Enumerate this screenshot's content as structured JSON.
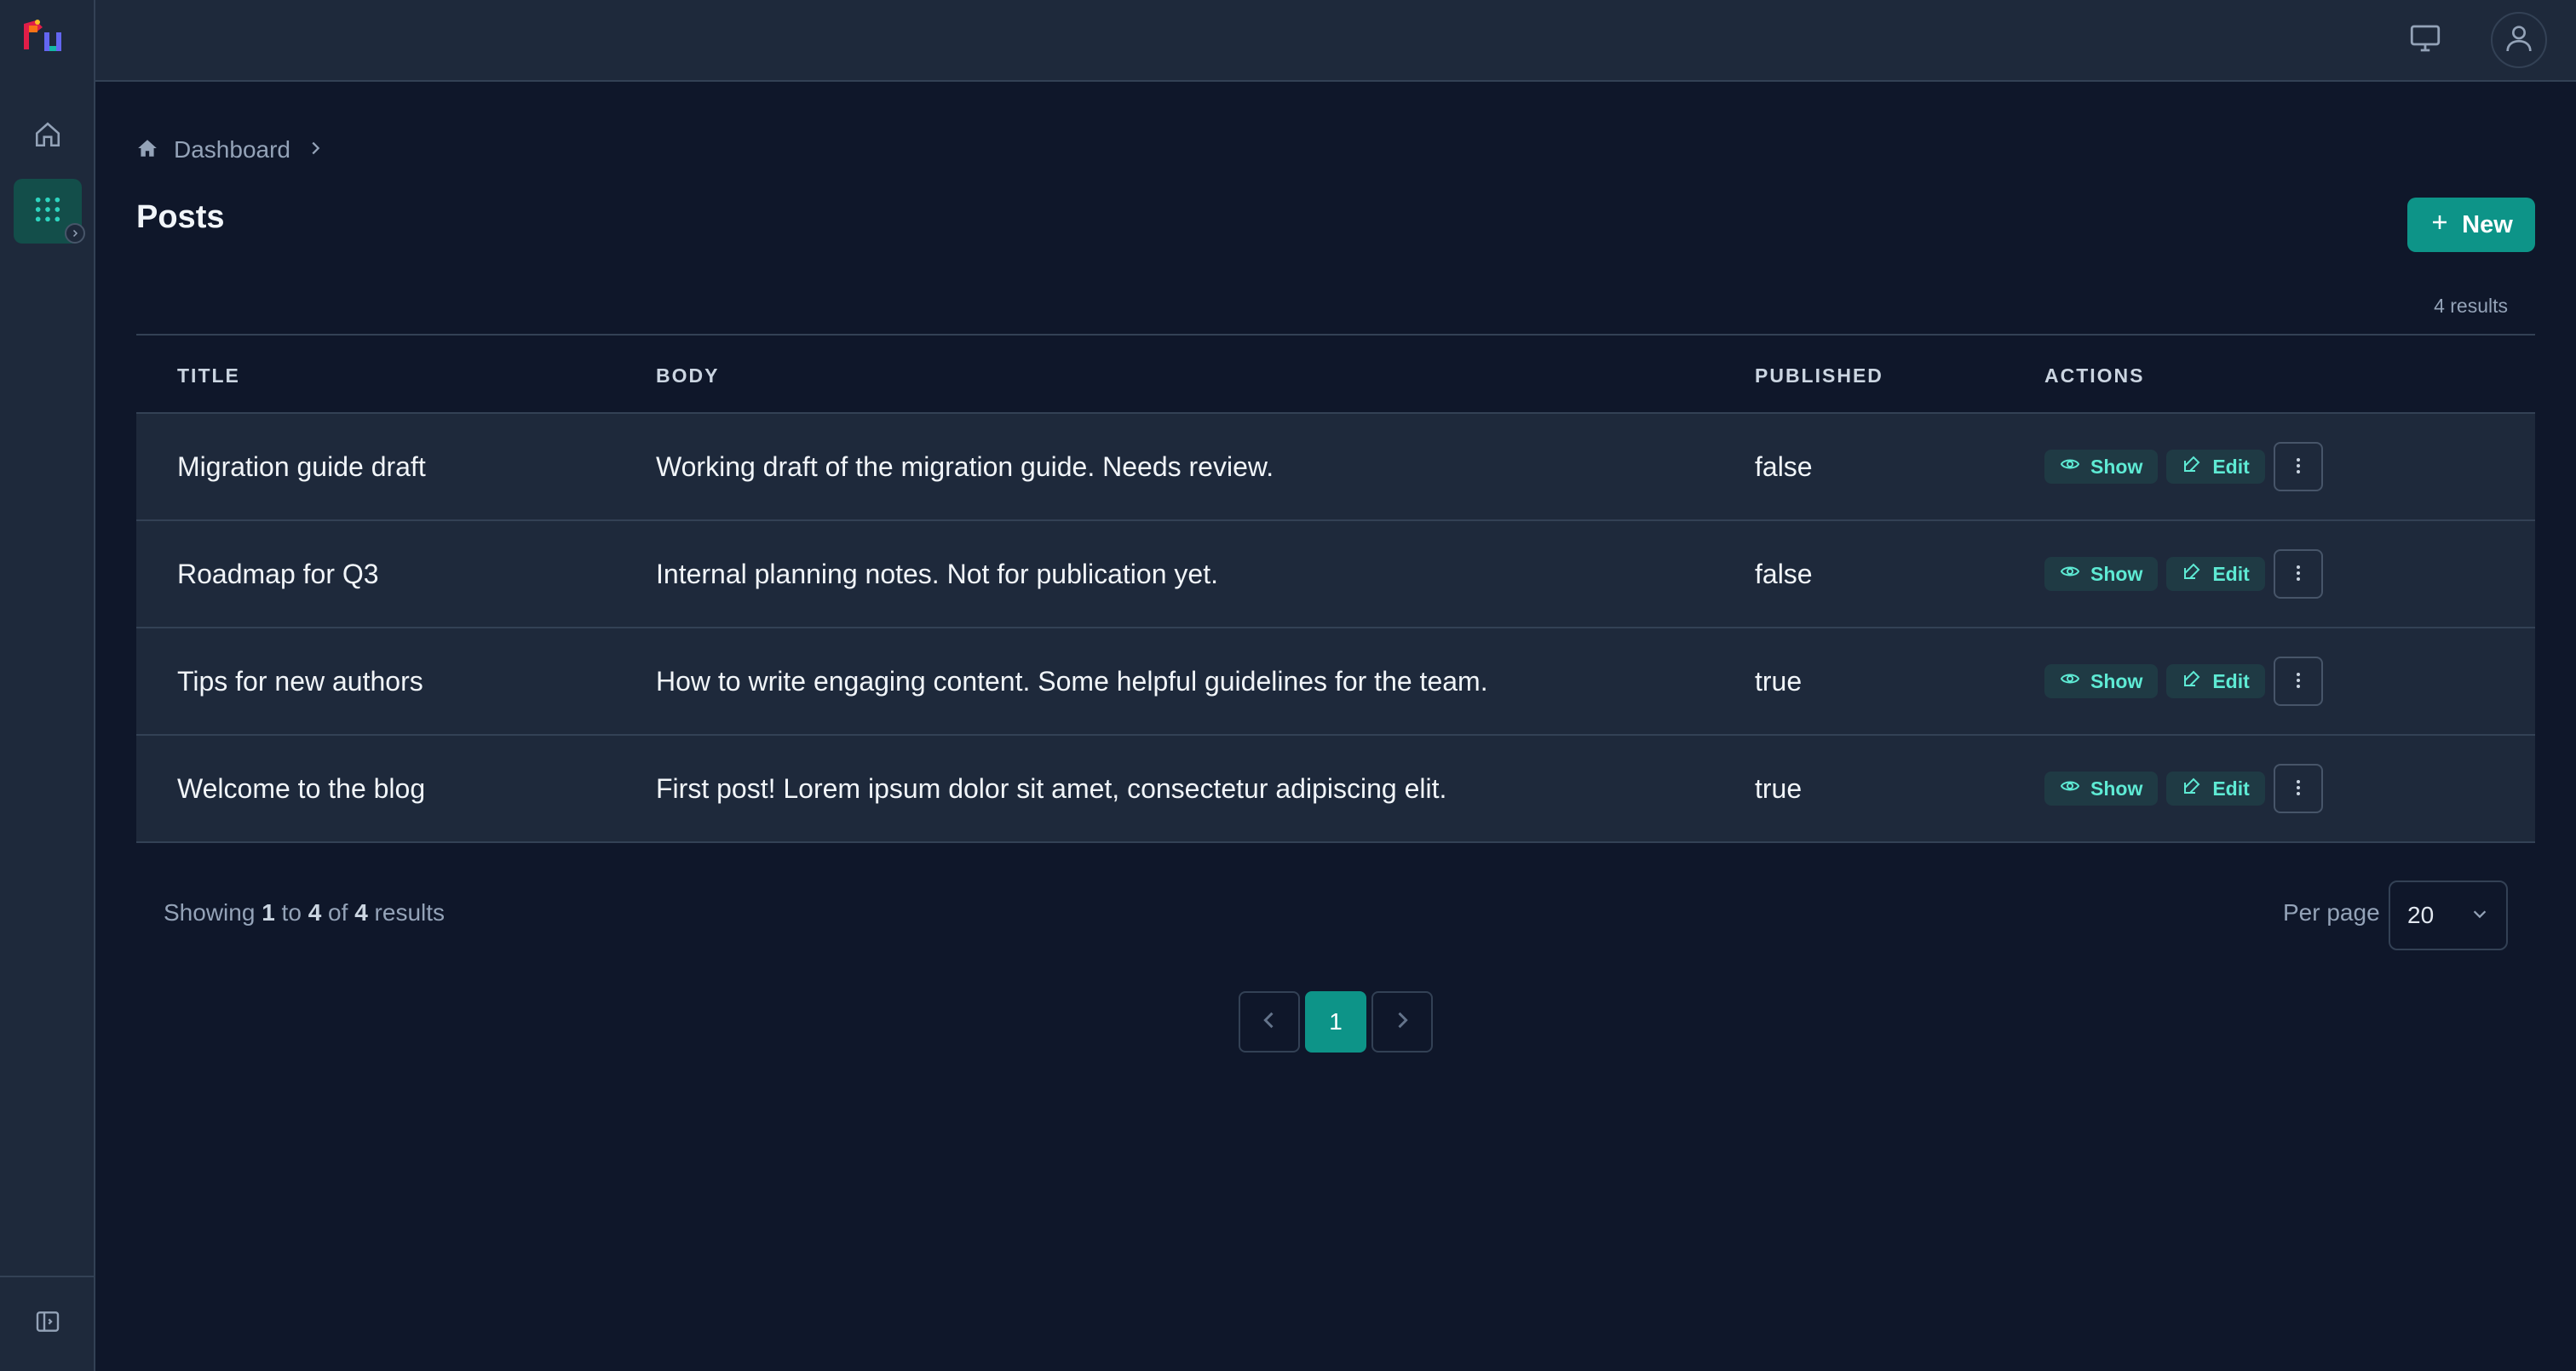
{
  "breadcrumb": {
    "home_icon": "home-icon",
    "current": "Dashboard"
  },
  "page": {
    "title": "Posts",
    "new_button": "New",
    "result_count": "4 results"
  },
  "table": {
    "headers": [
      "TITLE",
      "BODY",
      "PUBLISHED",
      "ACTIONS"
    ],
    "rows": [
      {
        "title": "Migration guide draft",
        "body": "Working draft of the migration guide. Needs review.",
        "published": "false"
      },
      {
        "title": "Roadmap for Q3",
        "body": "Internal planning notes. Not for publication yet.",
        "published": "false"
      },
      {
        "title": "Tips for new authors",
        "body": "How to write engaging content. Some helpful guidelines for the team.",
        "published": "true"
      },
      {
        "title": "Welcome to the blog",
        "body": "First post! Lorem ipsum dolor sit amet, consectetur adipiscing elit.",
        "published": "true"
      }
    ],
    "action_show": "Show",
    "action_edit": "Edit"
  },
  "footer": {
    "showing_prefix": "Showing",
    "showing_from": "1",
    "showing_to_word": "to",
    "showing_to": "4",
    "showing_of_word": "of",
    "showing_total": "4",
    "showing_suffix": "results",
    "per_page_label": "Per page",
    "per_page_value": "20",
    "current_page": "1"
  },
  "colors": {
    "accent": "#0d9488",
    "accent_text": "#5eead4",
    "background": "#0f172a",
    "panel": "#1e293b"
  }
}
